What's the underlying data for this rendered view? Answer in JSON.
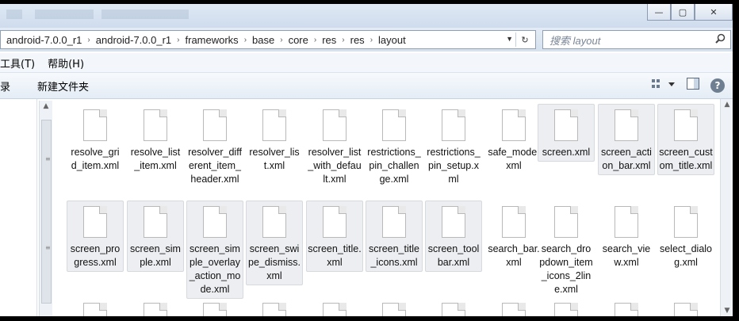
{
  "window": {
    "minimize_glyph": "—",
    "maximize_glyph": "▢",
    "close_glyph": "✕"
  },
  "address": {
    "crumbs": [
      "android-7.0.0_r1",
      "android-7.0.0_r1",
      "frameworks",
      "base",
      "core",
      "res",
      "res",
      "layout"
    ],
    "separator": "›",
    "dropdown_glyph": "▼",
    "refresh_glyph": "↻"
  },
  "search": {
    "placeholder": "搜索 layout",
    "icon": "search-icon"
  },
  "menu": {
    "items": [
      "工具(T)",
      "帮助(H)"
    ]
  },
  "commands": {
    "partial_left": "录",
    "new_folder": "新建文件夹",
    "view_icon": "views-icon",
    "preview_icon": "preview-pane-icon",
    "help_icon": "help-icon"
  },
  "files": [
    {
      "name": "resolve_grid_item.xml",
      "selected": false
    },
    {
      "name": "resolve_list_item.xml",
      "selected": false
    },
    {
      "name": "resolver_different_item_header.xml",
      "selected": false
    },
    {
      "name": "resolver_list.xml",
      "selected": false
    },
    {
      "name": "resolver_list_with_default.xml",
      "selected": false
    },
    {
      "name": "restrictions_pin_challenge.xml",
      "selected": false
    },
    {
      "name": "restrictions_pin_setup.xml",
      "selected": false
    },
    {
      "name": "safe_mode.xml",
      "selected": false
    },
    {
      "name": "screen.xml",
      "selected": true
    },
    {
      "name": "screen_action_bar.xml",
      "selected": true
    },
    {
      "name": "screen_custom_title.xml",
      "selected": true
    },
    {
      "name": "screen_progress.xml",
      "selected": true
    },
    {
      "name": "screen_simple.xml",
      "selected": true
    },
    {
      "name": "screen_simple_overlay_action_mode.xml",
      "selected": true
    },
    {
      "name": "screen_swipe_dismiss.xml",
      "selected": true
    },
    {
      "name": "screen_title.xml",
      "selected": true
    },
    {
      "name": "screen_title_icons.xml",
      "selected": true
    },
    {
      "name": "screen_toolbar.xml",
      "selected": true
    },
    {
      "name": "search_bar.xml",
      "selected": false
    },
    {
      "name": "search_dropdown_item_icons_2line.xml",
      "selected": false
    },
    {
      "name": "search_view.xml",
      "selected": false
    },
    {
      "name": "select_dialog.xml",
      "selected": false
    }
  ]
}
